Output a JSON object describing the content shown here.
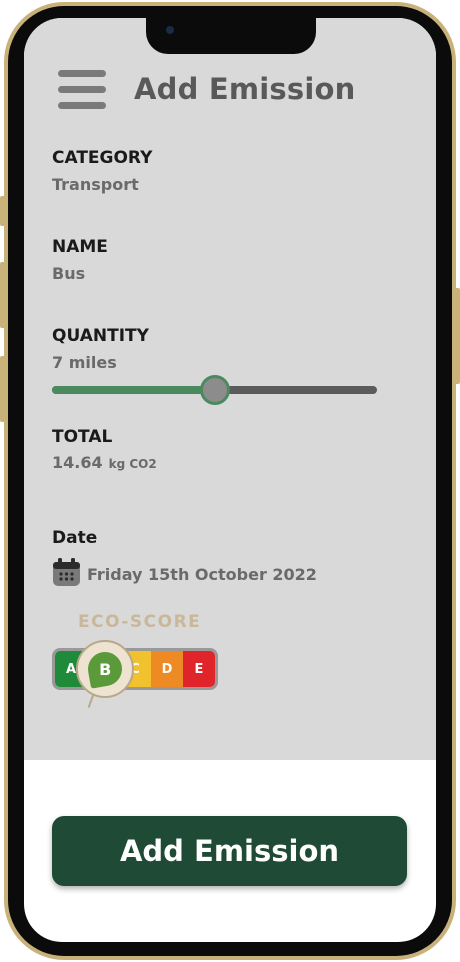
{
  "header": {
    "title": "Add Emission",
    "menu_icon": "hamburger-menu-icon"
  },
  "form": {
    "category": {
      "label": "CATEGORY",
      "value": "Transport"
    },
    "name": {
      "label": "NAME",
      "value": "Bus"
    },
    "quantity": {
      "label": "QUANTITY",
      "value": "7 miles",
      "slider_fraction": 0.5
    },
    "total": {
      "label": "TOTAL",
      "value": "14.64",
      "unit": "kg CO2"
    },
    "date": {
      "label": "Date",
      "value": "Friday 15th October 2022",
      "icon": "calendar-icon"
    }
  },
  "eco_score": {
    "title": "ECO-SCORE",
    "grades": [
      "A",
      "B",
      "C",
      "D",
      "E"
    ],
    "selected": "B",
    "colors": {
      "A": "#1f8a3a",
      "B": "#7ab83a",
      "C": "#f2c12e",
      "D": "#ee8a23",
      "E": "#e0252a"
    }
  },
  "actions": {
    "add_label": "Add Emission"
  },
  "colors": {
    "accent": "#4a8a5e",
    "button": "#1e4a36",
    "background": "#d9d9d9"
  }
}
